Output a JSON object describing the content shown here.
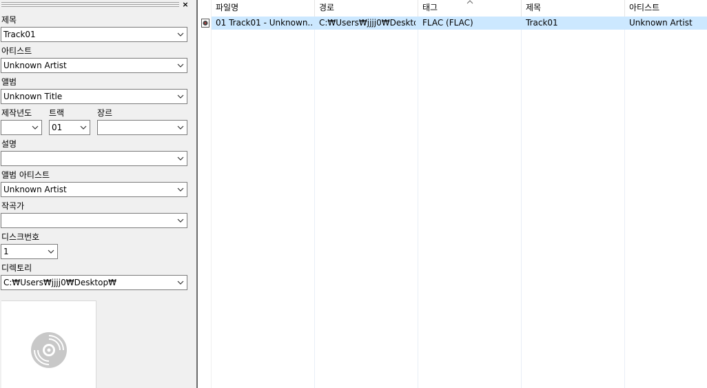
{
  "panel": {
    "close_label": "×",
    "fields": {
      "title_label": "제목",
      "title_value": "Track01",
      "artist_label": "아티스트",
      "artist_value": "Unknown Artist",
      "album_label": "앨범",
      "album_value": "Unknown Title",
      "year_label": "제작년도",
      "year_value": "",
      "track_label": "트랙",
      "track_value": "01",
      "genre_label": "장르",
      "genre_value": "",
      "comment_label": "설명",
      "comment_value": "",
      "album_artist_label": "앨범 아티스트",
      "album_artist_value": "Unknown Artist",
      "composer_label": "작곡가",
      "composer_value": "",
      "disc_label": "디스크번호",
      "disc_value": "1",
      "directory_label": "디렉토리",
      "directory_value": "C:₩Users₩jjjj0₩Desktop₩"
    },
    "album_art_icon": "disc-icon"
  },
  "list": {
    "sorted_column": "태그",
    "columns": [
      "파일명",
      "경로",
      "태그",
      "제목",
      "아티스트"
    ],
    "rows": [
      {
        "icon": "audio-file-icon",
        "filename": "01 Track01 - Unknown...",
        "path": "C:₩Users₩jjjj0₩Deskto...",
        "tag": "FLAC (FLAC)",
        "title": "Track01",
        "artist": "Unknown Artist",
        "selected": true
      }
    ]
  },
  "colors": {
    "selection": "#cce8ff",
    "panel_bg": "#f0f0f0",
    "splitter": "#696969"
  }
}
